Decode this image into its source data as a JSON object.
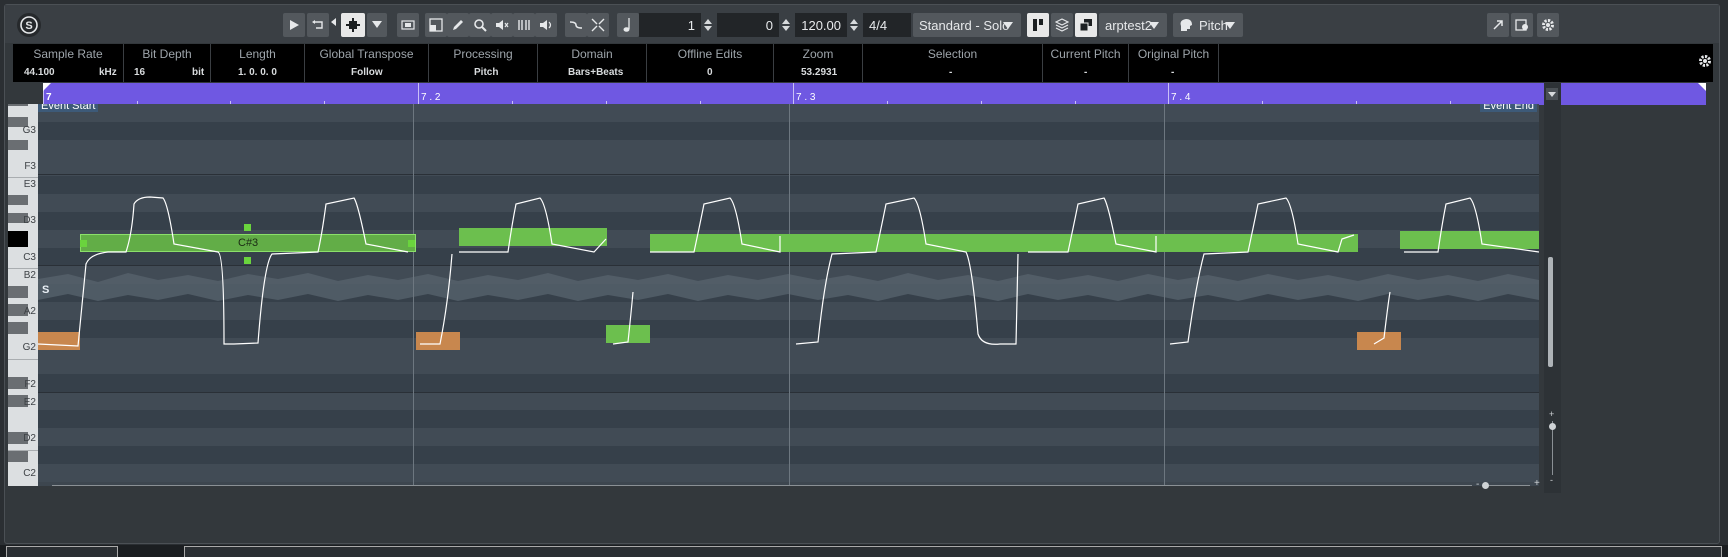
{
  "transport": {
    "numerator": "1",
    "denominator": "0",
    "tempo": "120.00",
    "signature": "4/4",
    "mode": "Standard - Solo",
    "file": "arptest2",
    "view": "Pitch"
  },
  "info": [
    {
      "label": "Sample Rate",
      "value": "44.100",
      "unit": "kHz"
    },
    {
      "label": "Bit Depth",
      "value": "16",
      "unit": "bit"
    },
    {
      "label": "Length",
      "value": "1. 0. 0.  0",
      "unit": ""
    },
    {
      "label": "Global Transpose",
      "value": "Follow",
      "unit": ""
    },
    {
      "label": "Processing",
      "value": "Pitch",
      "unit": ""
    },
    {
      "label": "Domain",
      "value": "Bars+Beats",
      "unit": ""
    },
    {
      "label": "Offline Edits",
      "value": "0",
      "unit": ""
    },
    {
      "label": "Zoom",
      "value": "53.2931",
      "unit": ""
    },
    {
      "label": "Selection",
      "value": "-",
      "unit": ""
    },
    {
      "label": "Current Pitch",
      "value": "-",
      "unit": ""
    },
    {
      "label": "Original Pitch",
      "value": "-",
      "unit": ""
    }
  ],
  "ruler": {
    "m1": "7",
    "m2": "7 . 2",
    "m3": "7 . 3",
    "m4": "7 . 4"
  },
  "event_start": "Event Start",
  "event_end": "Event End",
  "keyboard_labels": [
    "G3",
    "F3",
    "E3",
    "D3",
    "C3",
    "B2",
    "A2",
    "G2",
    "F2",
    "E2",
    "D2",
    "C2"
  ],
  "selected_note_label": "C#3",
  "segment_marker": "S",
  "colors": {
    "ruler": "#6f58e2",
    "note_green": "#6cbf4e",
    "note_orange": "#c8874e"
  }
}
